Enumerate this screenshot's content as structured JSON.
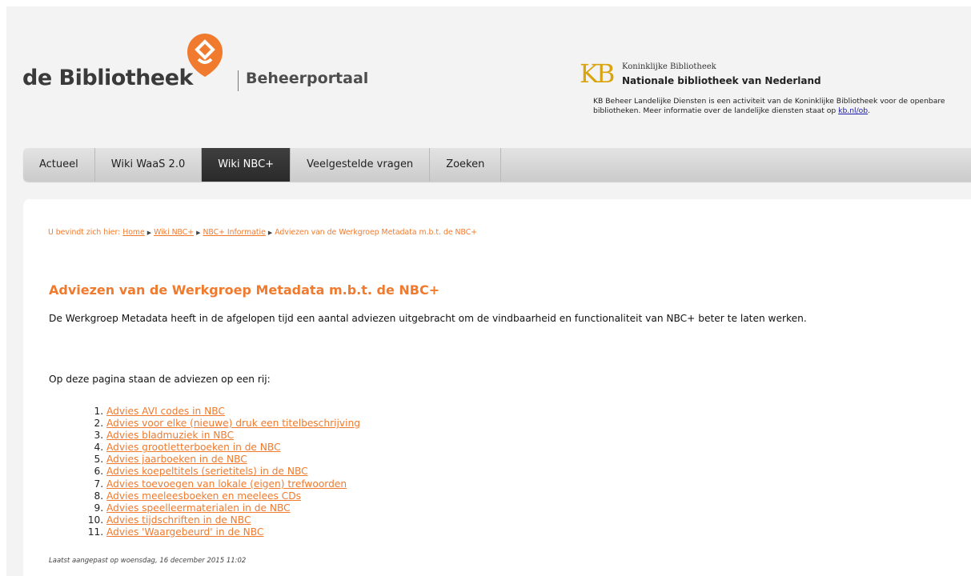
{
  "header": {
    "logo_text": "de Bibliotheek",
    "portal_title": "Beheerportaal",
    "kb_logo_letters": "KB",
    "kb_line1": "Koninklijke Bibliotheek",
    "kb_line2": "Nationale bibliotheek van Nederland",
    "kb_description": "KB Beheer Landelijke Diensten is een activiteit van de Koninklijke Bibliotheek voor de openbare bibliotheken. Meer informatie over de landelijke diensten staat op",
    "kb_link": "kb.nl/ob",
    "kb_period": "."
  },
  "nav": {
    "items": [
      {
        "label": "Actueel"
      },
      {
        "label": "Wiki WaaS 2.0"
      },
      {
        "label": "Wiki NBC+"
      },
      {
        "label": "Veelgestelde vragen"
      },
      {
        "label": "Zoeken"
      }
    ],
    "active_index": 2
  },
  "breadcrumb": {
    "prefix": "U bevindt zich hier:",
    "links": [
      "Home",
      "Wiki NBC+",
      "NBC+ Informatie"
    ],
    "current": "Adviezen van de Werkgroep Metadata m.b.t. de NBC+"
  },
  "main": {
    "title": "Adviezen van de Werkgroep Metadata m.b.t. de NBC+",
    "intro": "De Werkgroep Metadata heeft in de afgelopen tijd een aantal adviezen uitgebracht om de vindbaarheid en functionaliteit van NBC+ beter te laten werken.",
    "list_intro": "Op deze pagina staan de adviezen op een rij:",
    "adviezen": [
      "Advies AVI codes in NBC",
      "Advies voor elke (nieuwe) druk een titelbeschrijving",
      "Advies bladmuziek in NBC",
      "Advies grootletterboeken in de NBC",
      "Advies jaarboeken in de NBC",
      "Advies koepeltitels (serietitels) in de NBC",
      "Advies toevoegen van lokale (eigen) trefwoorden",
      "Advies meeleesboeken en meelees CDs",
      "Advies speelleermaterialen in de NBC",
      "Advies tijdschriften in de NBC",
      "Advies 'Waargebeurd' in de NBC"
    ],
    "last_modified": "Laatst aangepast op woensdag, 16 december 2015 11:02"
  },
  "colors": {
    "accent": "#f07a2e",
    "kb_gold": "#d9a410",
    "nav_active": "#333333"
  }
}
